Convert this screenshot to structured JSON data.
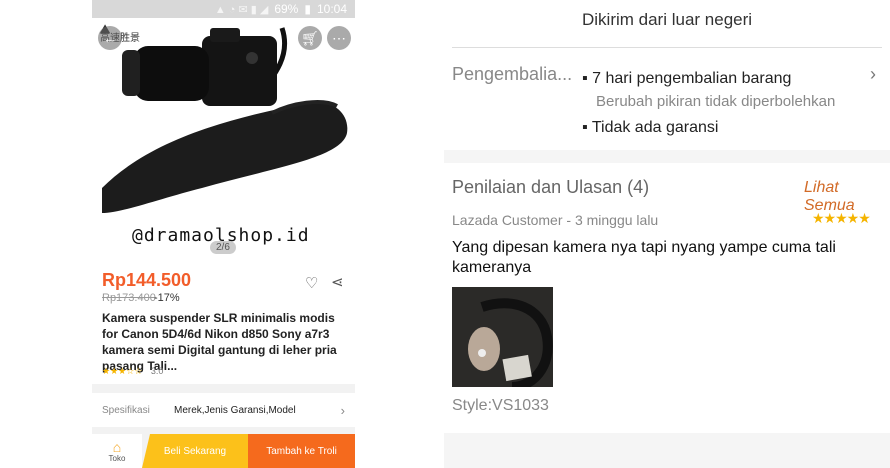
{
  "status_bar": {
    "battery": "69%",
    "time": "10:04"
  },
  "product": {
    "brand_logo": "高速胜景",
    "watermark": "@dramaolshop.id",
    "image_counter": "2/6",
    "price": "Rp144.500",
    "old_price": "Rp173.400",
    "discount": "-17%",
    "title": "Kamera suspender SLR minimalis modis for Canon 5D4/6d Nikon d850 Sony a7r3 kamera semi Digital gantung di leher pria pasang Tali...",
    "rating_value": "3.0",
    "rating_stars": "★★★☆☆"
  },
  "spec": {
    "label": "Spesifikasi",
    "value": "Merek,Jenis Garansi,Model"
  },
  "bottom_bar": {
    "toko": "Toko",
    "buy_now": "Beli Sekarang",
    "add_cart": "Tambah ke Troli"
  },
  "shipping": {
    "text": "Dikirim dari luar negeri"
  },
  "returns": {
    "label": "Pengembalia...",
    "item1": "7 hari pengembalian barang",
    "item1_sub": "Berubah pikiran tidak diperbolehkan",
    "item2": "Tidak ada garansi"
  },
  "reviews": {
    "title": "Penilaian dan Ulasan (4)",
    "see_all": "Lihat Semua",
    "author": "Lazada Customer - 3  minggu lalu",
    "stars": "★★★★★",
    "text": "Yang dipesan kamera nya tapi nyang yampe cuma tali kameranya",
    "style": "Style:VS1033"
  },
  "colors": {
    "accent": "#f25d2a",
    "buy_now": "#fcc11a",
    "add_cart": "#f56a1d",
    "star": "#f5b400",
    "link": "#d26b28"
  },
  "icons": [
    "back-arrow-icon",
    "cart-icon",
    "more-icon",
    "heart-icon",
    "share-icon",
    "chevron-right-icon",
    "store-icon"
  ]
}
